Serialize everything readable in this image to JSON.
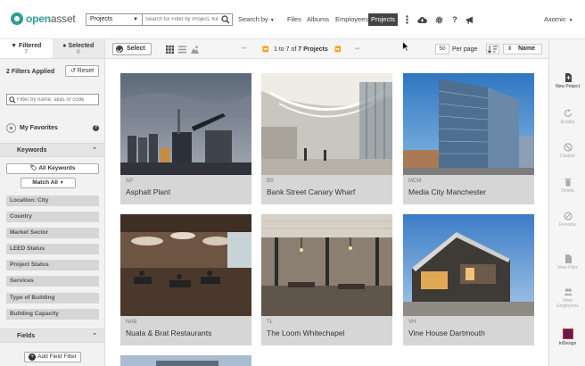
{
  "nav": {
    "logo_brand": "open",
    "logo_rest": "asset",
    "scope_value": "Projects",
    "search_placeholder": "Search for Filter by Project, Ke",
    "search_by_label": "Search by",
    "links": [
      "Files",
      "Albums",
      "Employees"
    ],
    "active_link": "Projects",
    "user": "Axomic"
  },
  "sidebar": {
    "tabs": [
      {
        "label": "Filtered",
        "count": "7"
      },
      {
        "label": "Selected",
        "count": "0"
      }
    ],
    "filters_applied": "2 Filters Applied",
    "reset_label": "Reset",
    "filter_search_placeholder": "Filter by name, alias or code",
    "favorites_label": "My Favorites",
    "keywords_head": "Keywords",
    "all_keywords_label": "All Keywords",
    "match_all_label": "Match All",
    "keyword_items": [
      "Location: City",
      "Country",
      "Market Sector",
      "LEED Status",
      "Project Status",
      "Services",
      "Type of Building",
      "Building Capacity"
    ],
    "fields_head": "Fields",
    "add_field_label": "Add Field Filter"
  },
  "toolbar": {
    "select_label": "Select",
    "pager_prefix": "1 to 7 of ",
    "pager_bold": "7 Projects",
    "per_page_value": "50",
    "per_page_label": "Per page",
    "sort_field": "Name"
  },
  "projects": [
    {
      "code": "AP",
      "name": "Asphalt Plant"
    },
    {
      "code": "BS",
      "name": "Bank Street Canary Wharf"
    },
    {
      "code": "MCM",
      "name": "Media City Manchester"
    },
    {
      "code": "NAB",
      "name": "Nuala & Brat Restaurants"
    },
    {
      "code": "TL",
      "name": "The Loom Whitechapel"
    },
    {
      "code": "VH",
      "name": "Vine House Dartmouth"
    }
  ],
  "rightbar": {
    "new_project": "New Project",
    "enable": "Enable",
    "disable": "Disable",
    "delete": "Delete",
    "rename": "Rename",
    "view_files": "View Files",
    "view_employees_1": "View",
    "view_employees_2": "Employees",
    "indesign": "InDesign"
  }
}
